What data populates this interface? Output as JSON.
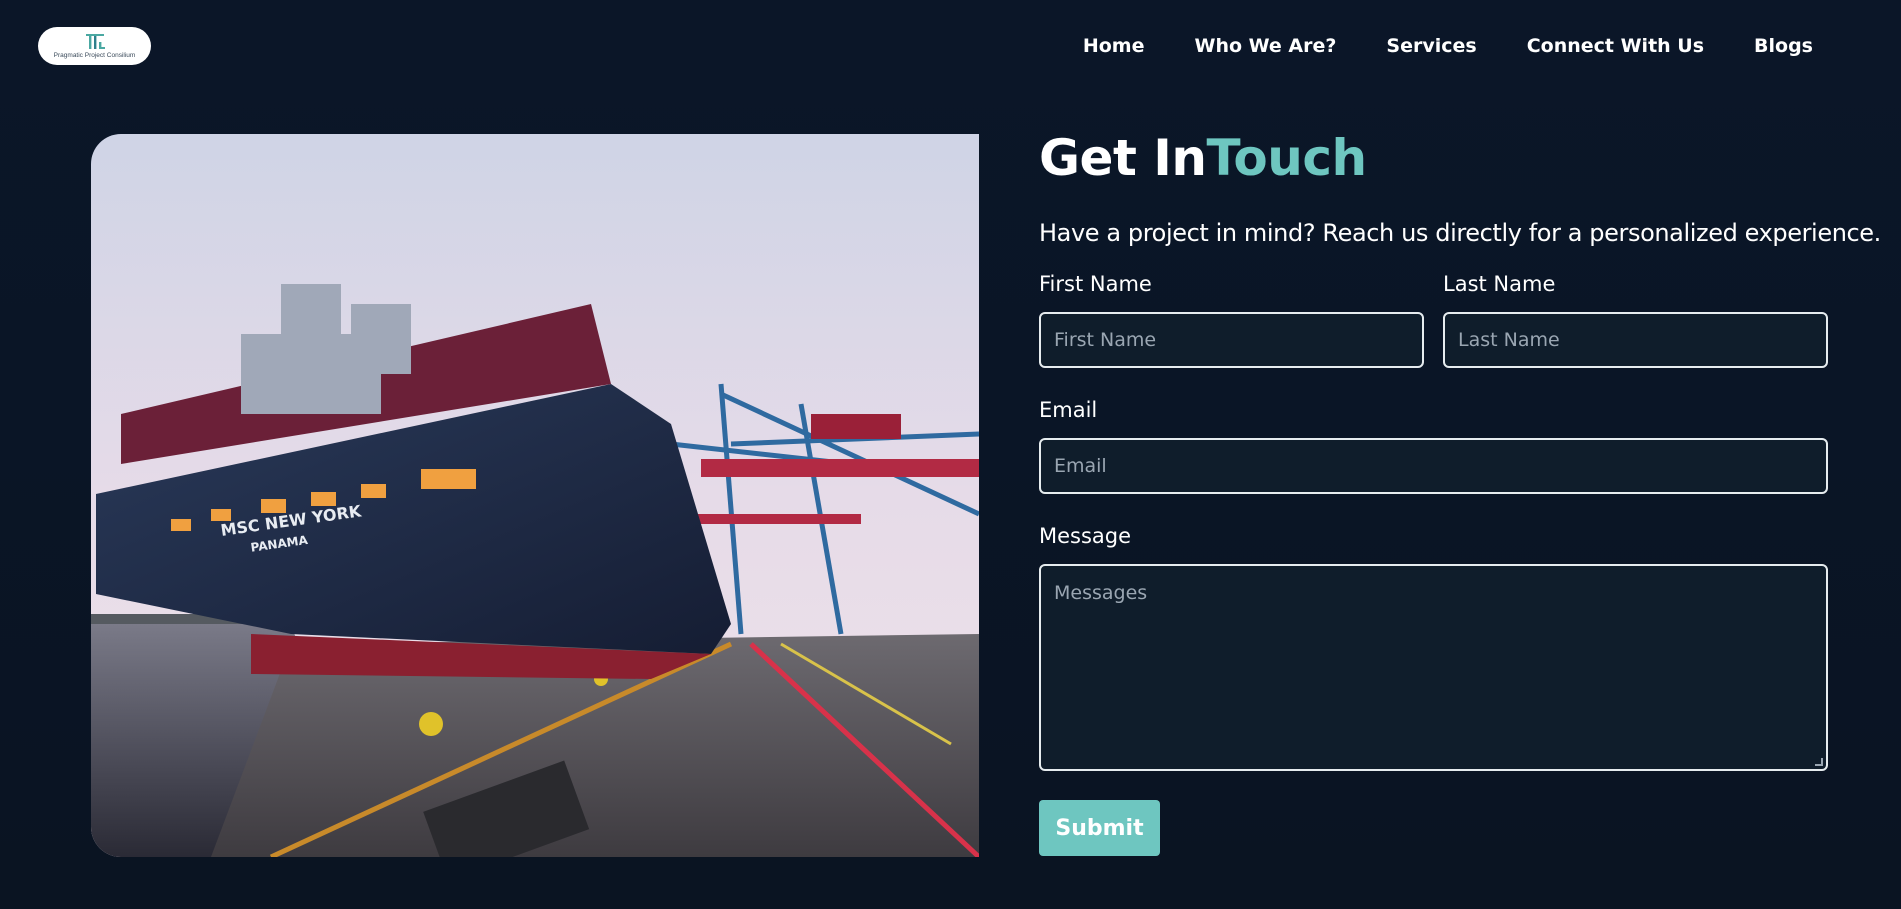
{
  "logo": {
    "text": "Pragmatic Project Consilium",
    "icon": "logo-pillars-icon"
  },
  "nav": {
    "items": [
      {
        "label": "Home"
      },
      {
        "label": "Who We Are?"
      },
      {
        "label": "Services"
      },
      {
        "label": "Connect With Us"
      },
      {
        "label": "Blogs"
      }
    ]
  },
  "hero": {
    "ship_name": "MSC NEW YORK",
    "ship_port": "PANAMA"
  },
  "contact": {
    "title_main": "Get In",
    "title_accent": "Touch",
    "subtitle": "Have a project in mind? Reach us directly for a personalized experience.",
    "first_name_label": "First Name",
    "first_name_placeholder": "First Name",
    "last_name_label": "Last Name",
    "last_name_placeholder": "Last Name",
    "email_label": "Email",
    "email_placeholder": "Email",
    "message_label": "Message",
    "message_placeholder": "Messages",
    "submit_label": "Submit"
  },
  "colors": {
    "background": "#0b1628",
    "accent": "#6ec6c0",
    "field_bg": "#0f1d2b",
    "field_border": "#e6ecef"
  }
}
